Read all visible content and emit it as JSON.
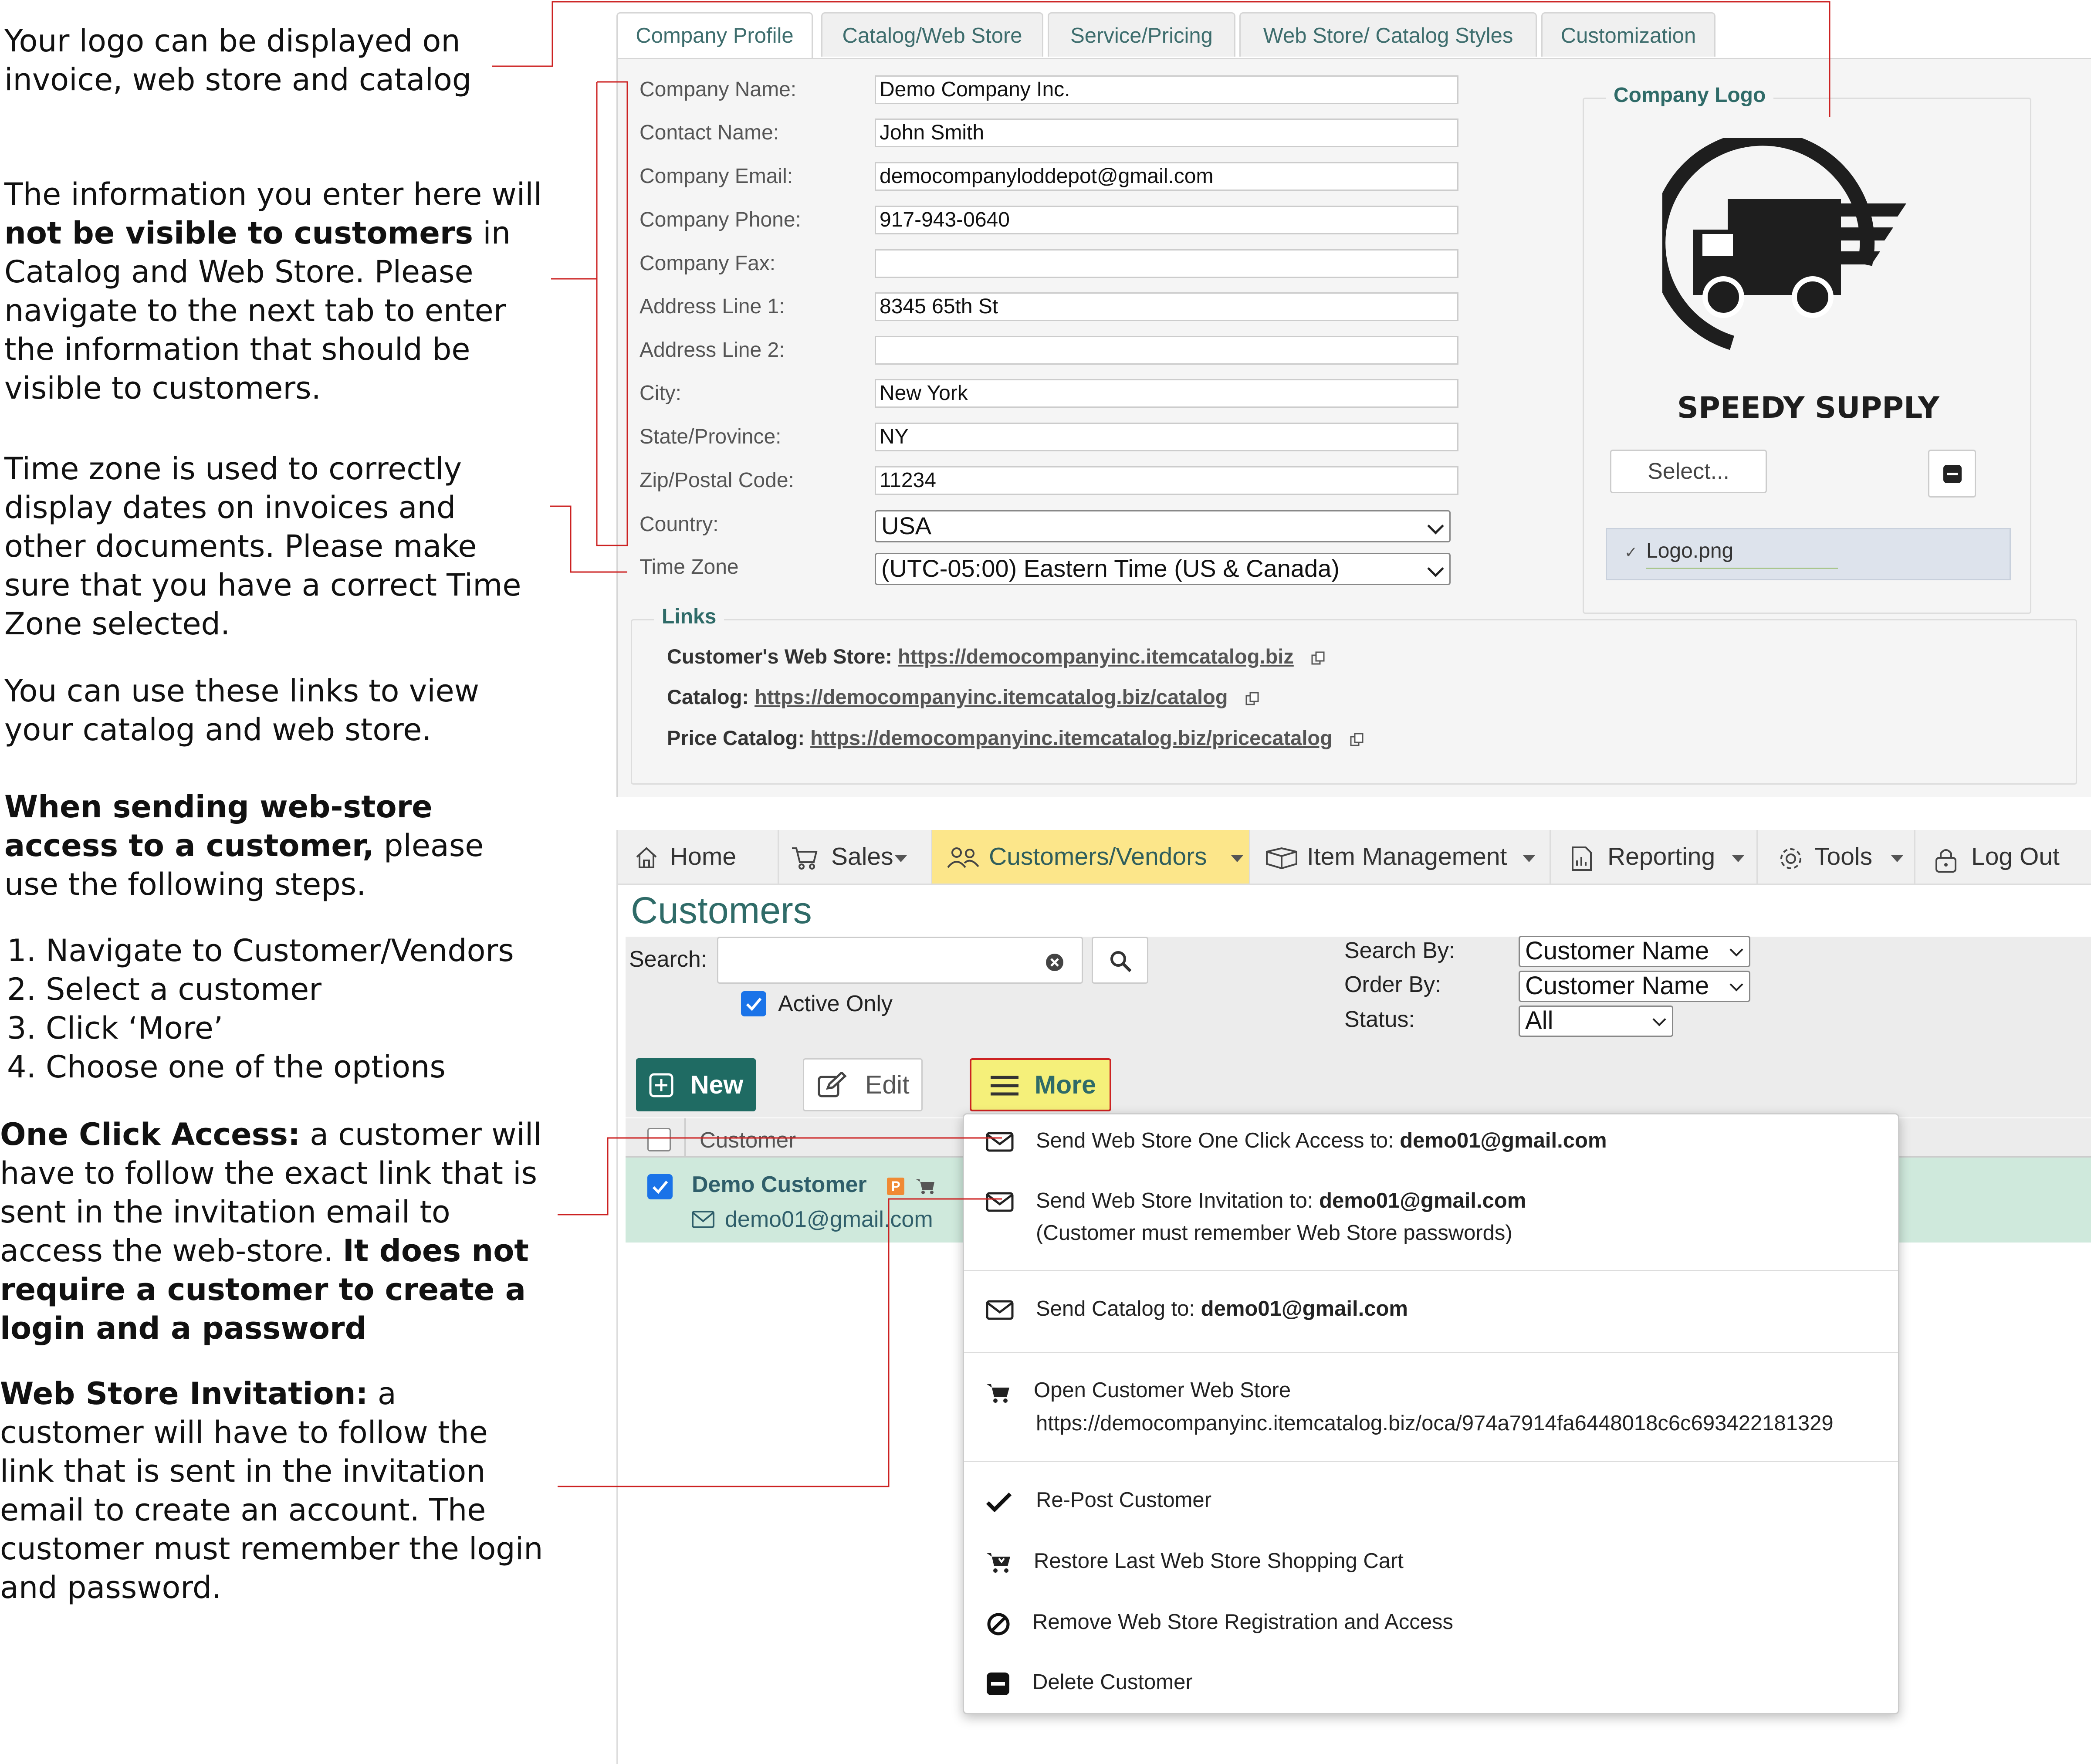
{
  "annotations": {
    "logo": "Your logo can be displayed on invoice, web store and catalog",
    "info_1": "The information you enter here will ",
    "info_bold": "not be visible to customers",
    "info_2": " in Catalog and Web Store. Please navigate to the next tab to enter the information that should be visible to customers.",
    "timezone": "Time zone is used to correctly display dates on invoices and other documents. Please make sure that you have a correct Time Zone selected.",
    "links": "You can use these links to view your catalog and web store.",
    "steps_bold": "When sending web-store access to a customer,",
    "steps_rest": " please use the following steps.",
    "steps": [
      "Navigate to Customer/Vendors",
      "Select a customer",
      "Click ‘More’",
      "Choose one of the options"
    ],
    "oca_bold": "One Click Access:",
    "oca_text": " a customer will have to follow the exact link that is sent in the invitation email to access the web-store. ",
    "oca_bold2": "It does not require a customer to create a login and a password",
    "inv_bold": "Web Store Invitation:",
    "inv_text": " a customer will have to follow the link that is sent in the invitation email to create an account. The customer must remember the login and password."
  },
  "profile": {
    "tabs": [
      "Company Profile",
      "Catalog/Web Store",
      "Service/Pricing",
      "Web Store/ Catalog Styles",
      "Customization"
    ],
    "fields": [
      {
        "label": "Company Name:",
        "value": "Demo Company Inc."
      },
      {
        "label": "Contact Name:",
        "value": "John Smith"
      },
      {
        "label": "Company Email:",
        "value": "democompanyloddepot@gmail.com"
      },
      {
        "label": "Company Phone:",
        "value": "917-943-0640"
      },
      {
        "label": "Company Fax:",
        "value": ""
      },
      {
        "label": "Address Line 1:",
        "value": "8345 65th St"
      },
      {
        "label": "Address Line 2:",
        "value": ""
      },
      {
        "label": "City:",
        "value": "New York"
      },
      {
        "label": "State/Province:",
        "value": "NY"
      },
      {
        "label": "Zip/Postal Code:",
        "value": "11234"
      }
    ],
    "country_label": "Country:",
    "country_value": "USA",
    "timezone_label": "Time Zone",
    "timezone_value": "(UTC-05:00) Eastern Time (US & Canada)",
    "logo_legend": "Company Logo",
    "logo_brand_text": "SPEEDY SUPPLY",
    "select_button": "Select...",
    "logo_file": "Logo.png",
    "links_legend": "Links",
    "links": [
      {
        "label": "Customer's Web Store:",
        "url": "https://democompanyinc.itemcatalog.biz"
      },
      {
        "label": "Catalog:",
        "url": "https://democompanyinc.itemcatalog.biz/catalog"
      },
      {
        "label": "Price Catalog:",
        "url": "https://democompanyinc.itemcatalog.biz/pricecatalog"
      }
    ]
  },
  "customers": {
    "nav": [
      "Home",
      "Sales",
      "Customers/Vendors",
      "Item Management",
      "Reporting",
      "Tools",
      "Log Out"
    ],
    "title": "Customers",
    "search_label": "Search:",
    "search_value": "",
    "active_only": "Active Only",
    "search_by_label": "Search By:",
    "search_by_value": "Customer Name",
    "order_by_label": "Order By:",
    "order_by_value": "Customer Name",
    "status_label": "Status:",
    "status_value": "All",
    "new_button": "New",
    "edit_button": "Edit",
    "more_button": "More",
    "column_customer": "Customer",
    "row": {
      "name": "Demo Customer",
      "badge": "P",
      "email": "demo01@gmail.com"
    },
    "menu": {
      "oca_label": "Send Web Store One Click Access to: ",
      "oca_email": "demo01@gmail.com",
      "inv_label": "Send Web Store Invitation to: ",
      "inv_email": "demo01@gmail.com",
      "inv_note": "(Customer must remember Web Store passwords)",
      "catalog_label": "Send Catalog to: ",
      "catalog_email": "demo01@gmail.com",
      "open_label": "Open Customer Web Store",
      "open_url": "https://democompanyinc.itemcatalog.biz/oca/974a7914fa6448018c6c693422181329",
      "repost": "Re-Post Customer",
      "restore": "Restore Last Web Store Shopping Cart",
      "remove": "Remove Web Store Registration and Access",
      "delete": "Delete Customer"
    }
  },
  "colors": {
    "accent_teal": "#2f6b68",
    "nav_active": "#fce68a",
    "more_button": "#f5f07a",
    "annotation_line": "#cc2222",
    "new_button": "#1f6b63",
    "row_selected": "#cfe9dc"
  }
}
